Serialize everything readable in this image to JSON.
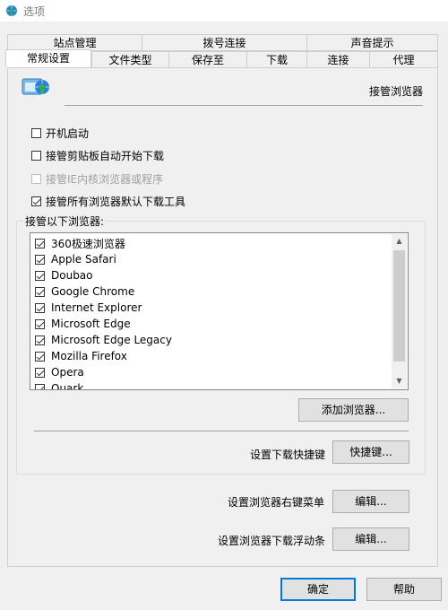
{
  "window": {
    "title": "选项",
    "icon": "app-globe-arrow-icon"
  },
  "tabs": {
    "row1": [
      "站点管理",
      "拨号连接",
      "声音提示"
    ],
    "row2": [
      "常规设置",
      "文件类型",
      "保存至",
      "下载",
      "连接",
      "代理"
    ],
    "active": "常规设置"
  },
  "section": {
    "header": "接管浏览器",
    "icon": "browser-integration-icon"
  },
  "options": [
    {
      "label": "开机启动",
      "checked": false,
      "enabled": true
    },
    {
      "label": "接管剪贴板自动开始下载",
      "checked": false,
      "enabled": true
    },
    {
      "label": "接管IE内核浏览器或程序",
      "checked": false,
      "enabled": false
    },
    {
      "label": "接管所有浏览器默认下载工具",
      "checked": true,
      "enabled": true
    }
  ],
  "browsers_group": {
    "label": "接管以下浏览器:",
    "items": [
      {
        "label": "360极速浏览器",
        "checked": true
      },
      {
        "label": "Apple Safari",
        "checked": true
      },
      {
        "label": "Doubao",
        "checked": true
      },
      {
        "label": "Google Chrome",
        "checked": true
      },
      {
        "label": "Internet Explorer",
        "checked": true
      },
      {
        "label": "Microsoft Edge",
        "checked": true
      },
      {
        "label": "Microsoft Edge Legacy",
        "checked": true
      },
      {
        "label": "Mozilla Firefox",
        "checked": true
      },
      {
        "label": "Opera",
        "checked": true
      },
      {
        "label": "Quark",
        "checked": true
      }
    ],
    "add_button": "添加浏览器...",
    "hotkey_label": "设置下载快捷键",
    "hotkey_button": "快捷键..."
  },
  "context_menu": {
    "label": "设置浏览器右键菜单",
    "button": "编辑..."
  },
  "floating_bar": {
    "label": "设置浏览器下载浮动条",
    "button": "编辑..."
  },
  "footer": {
    "ok": "确定",
    "help": "帮助"
  }
}
